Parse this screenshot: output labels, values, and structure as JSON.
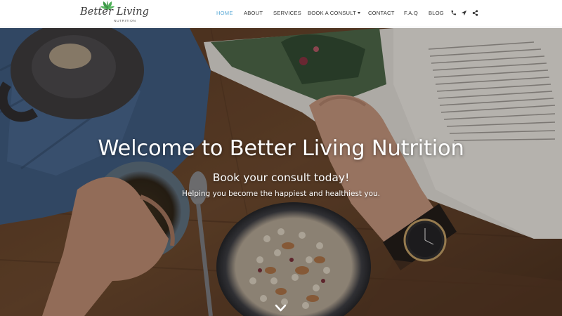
{
  "brand": {
    "logo_script": "Better Living",
    "logo_sub": "NUTRITION"
  },
  "nav": {
    "home": "HOME",
    "about": "ABOUT",
    "services": "SERVICES",
    "book": "BOOK A CONSULT",
    "contact": "CONTACT",
    "faq": "F.A.Q",
    "blog": "BLOG",
    "icons": [
      "phone-icon",
      "location-arrow-icon",
      "share-icon"
    ],
    "active_color": "#5aa9d6"
  },
  "hero": {
    "title": "Welcome to Better Living Nutrition",
    "subtitle": "Book your consult today!",
    "tagline": "Helping you become the happiest and healthiest you.",
    "scroll_icon": "chevron-down-icon"
  },
  "colors": {
    "accent": "#5aa9d6",
    "logo_leaf": "#3f9a4a",
    "text_dark": "#333333"
  }
}
